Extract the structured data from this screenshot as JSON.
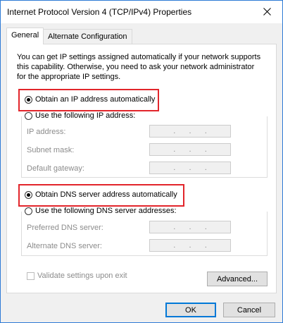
{
  "window": {
    "title": "Internet Protocol Version 4 (TCP/IPv4) Properties",
    "close_glyph": "✕"
  },
  "tabs": [
    {
      "label": "General",
      "active": true
    },
    {
      "label": "Alternate Configuration",
      "active": false
    }
  ],
  "description": "You can get IP settings assigned automatically if your network supports this capability. Otherwise, you need to ask your network administrator for the appropriate IP settings.",
  "ip": {
    "auto_label": "Obtain an IP address automatically",
    "auto_selected": true,
    "manual_label": "Use the following IP address:",
    "manual_selected": false,
    "fields": [
      {
        "label": "IP address:",
        "value": ". . ."
      },
      {
        "label": "Subnet mask:",
        "value": ". . ."
      },
      {
        "label": "Default gateway:",
        "value": ". . ."
      }
    ]
  },
  "dns": {
    "auto_label": "Obtain DNS server address automatically",
    "auto_selected": true,
    "manual_label": "Use the following DNS server addresses:",
    "manual_selected": false,
    "fields": [
      {
        "label": "Preferred DNS server:",
        "value": ". . ."
      },
      {
        "label": "Alternate DNS server:",
        "value": ". . ."
      }
    ]
  },
  "validate": {
    "label": "Validate settings upon exit",
    "checked": false,
    "enabled": false
  },
  "buttons": {
    "advanced": "Advanced...",
    "ok": "OK",
    "cancel": "Cancel"
  },
  "colors": {
    "highlight": "#e2252b",
    "window_border": "#2e7bd6",
    "default_button": "#0078d7"
  }
}
